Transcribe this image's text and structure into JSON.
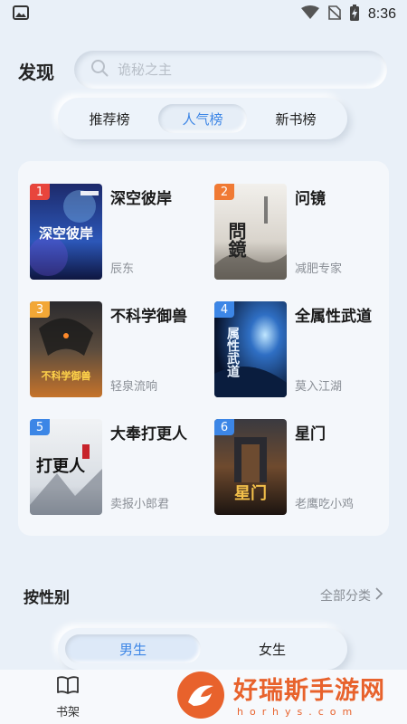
{
  "status_bar": {
    "time": "8:36"
  },
  "header": {
    "title": "发现",
    "search_placeholder": "诡秘之主"
  },
  "rank_tabs": [
    {
      "label": "推荐榜",
      "active": false
    },
    {
      "label": "人气榜",
      "active": true
    },
    {
      "label": "新书榜",
      "active": false
    }
  ],
  "books": [
    {
      "rank": "1",
      "title": "深空彼岸",
      "author": "辰东",
      "badge_color": "#e8453c"
    },
    {
      "rank": "2",
      "title": "问镜",
      "author": "减肥专家",
      "badge_color": "#f07a34"
    },
    {
      "rank": "3",
      "title": "不科学御兽",
      "author": "轻泉流响",
      "badge_color": "#f2a736"
    },
    {
      "rank": "4",
      "title": "全属性武道",
      "author": "莫入江湖",
      "badge_color": "#3c86e6"
    },
    {
      "rank": "5",
      "title": "大奉打更人",
      "author": "卖报小郎君",
      "badge_color": "#3c86e6"
    },
    {
      "rank": "6",
      "title": "星门",
      "author": "老鹰吃小鸡",
      "badge_color": "#3c86e6"
    }
  ],
  "covers": {
    "c1_art": "深空彼岸",
    "c2_art": "問鏡",
    "c3_art": "不科学御兽",
    "c4_art": "属性武道",
    "c5_art": "打更人",
    "c6_art": "星门"
  },
  "gender_section": {
    "title": "按性别",
    "all_categories": "全部分类",
    "tabs": [
      {
        "label": "男生",
        "active": true
      },
      {
        "label": "女生",
        "active": false
      }
    ]
  },
  "bottom_nav": {
    "items": [
      {
        "label": "书架",
        "icon": "book-icon"
      }
    ]
  },
  "watermark": {
    "main": "好瑞斯手游网",
    "sub": "horhys.com"
  },
  "colors": {
    "accent": "#3d86e6",
    "background": "#e9f0f8",
    "watermark": "#e8622c"
  }
}
